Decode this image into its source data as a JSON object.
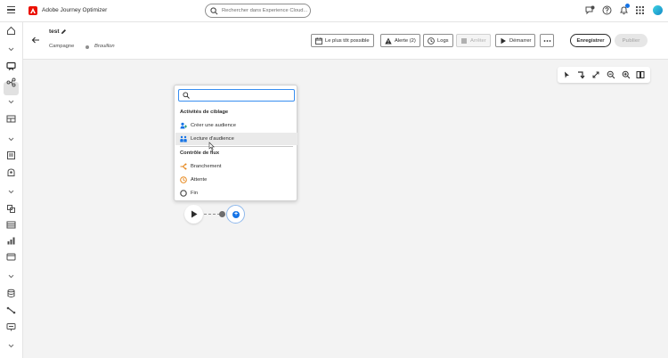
{
  "app": {
    "name": "Adobe Journey Optimizer"
  },
  "search": {
    "placeholder": "Rechercher dans Experience Cloud..."
  },
  "campaign": {
    "name": "test",
    "type": "Campagne",
    "status": "Brouillon"
  },
  "toolbar": {
    "schedule_label": "Le plus tôt possible",
    "alert_label": "Alerte (2)",
    "logs_label": "Logs",
    "stop_label": "Arrêter",
    "start_label": "Démarrer",
    "save_label": "Enregistrer",
    "publish_label": "Publier"
  },
  "activity_picker": {
    "search_value": "",
    "sections": [
      {
        "heading": "Activités de ciblage",
        "items": [
          {
            "label": "Créer une audience",
            "icon": "create-audience-icon"
          },
          {
            "label": "Lecture d'audience",
            "icon": "read-audience-icon"
          }
        ]
      },
      {
        "heading": "Contrôle de flux",
        "items": [
          {
            "label": "Branchement",
            "icon": "fork-icon"
          },
          {
            "label": "Attente",
            "icon": "wait-icon"
          },
          {
            "label": "Fin",
            "icon": "end-icon"
          }
        ]
      }
    ],
    "hovered_item": "Lecture d'audience"
  },
  "colors": {
    "accent": "#1473e6",
    "brand": "#eb1000",
    "avatar": "#1489c7"
  }
}
